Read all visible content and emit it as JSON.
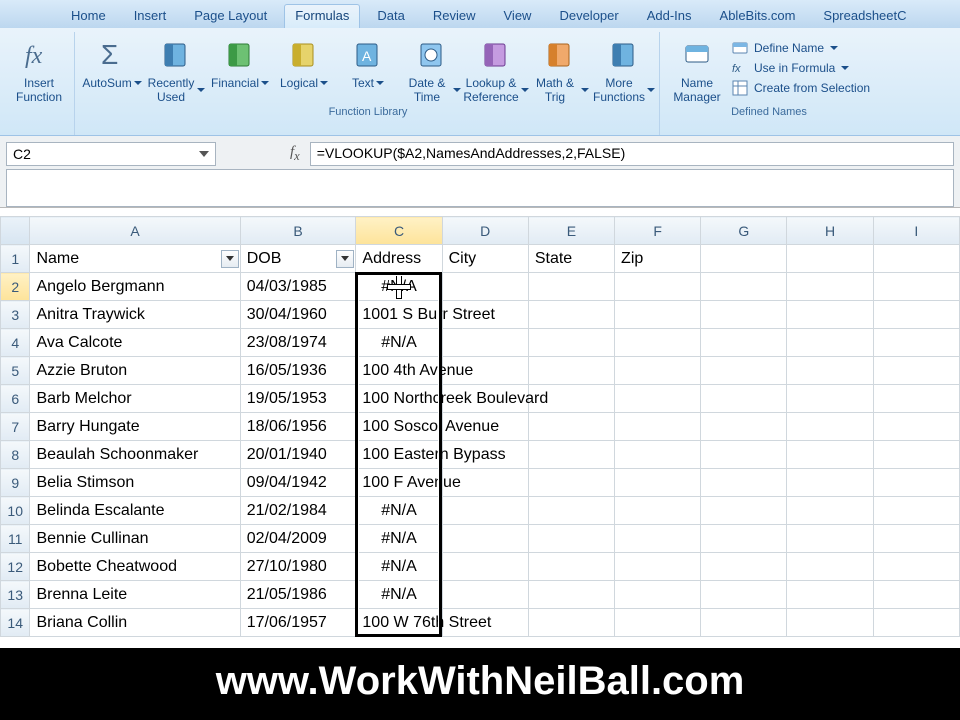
{
  "tabs": {
    "items": [
      "Home",
      "Insert",
      "Page Layout",
      "Formulas",
      "Data",
      "Review",
      "View",
      "Developer",
      "Add-Ins",
      "AbleBits.com",
      "SpreadsheetC"
    ],
    "activeIndex": 3
  },
  "ribbon": {
    "insertFunction": "Insert Function",
    "autosum": "AutoSum",
    "recent": "Recently Used",
    "financial": "Financial",
    "logical": "Logical",
    "text": "Text",
    "datetime": "Date & Time",
    "lookup": "Lookup & Reference",
    "math": "Math & Trig",
    "more": "More Functions",
    "nameMgr": "Name Manager",
    "defineName": "Define Name",
    "useInFormula": "Use in Formula",
    "createFromSel": "Create from Selection",
    "groupLibrary": "Function Library",
    "groupDefined": "Defined Names"
  },
  "formulaBar": {
    "nameBox": "C2",
    "formula": "=VLOOKUP($A2,NamesAndAddresses,2,FALSE)"
  },
  "columns": [
    "A",
    "B",
    "C",
    "D",
    "E",
    "F",
    "G",
    "H",
    "I"
  ],
  "headers": {
    "A": "Name",
    "B": "DOB",
    "C": "Address",
    "D": "City",
    "E": "State",
    "F": "Zip"
  },
  "rows": [
    {
      "n": "2",
      "name": "Angelo Bergmann",
      "dob": "04/03/1985",
      "addr": "#N/A"
    },
    {
      "n": "3",
      "name": "Anitra Traywick",
      "dob": "30/04/1960",
      "addr": "1001 S Burr Street"
    },
    {
      "n": "4",
      "name": "Ava Calcote",
      "dob": "23/08/1974",
      "addr": "#N/A"
    },
    {
      "n": "5",
      "name": "Azzie Bruton",
      "dob": "16/05/1936",
      "addr": "100 4th Avenue"
    },
    {
      "n": "6",
      "name": "Barb Melchor",
      "dob": "19/05/1953",
      "addr": "100 Northcreek Boulevard"
    },
    {
      "n": "7",
      "name": "Barry Hungate",
      "dob": "18/06/1956",
      "addr": "100 Soscol Avenue"
    },
    {
      "n": "8",
      "name": "Beaulah Schoonmaker",
      "dob": "20/01/1940",
      "addr": "100 Eastern Bypass"
    },
    {
      "n": "9",
      "name": "Belia Stimson",
      "dob": "09/04/1942",
      "addr": "100 F Avenue"
    },
    {
      "n": "10",
      "name": "Belinda Escalante",
      "dob": "21/02/1984",
      "addr": "#N/A"
    },
    {
      "n": "11",
      "name": "Bennie Cullinan",
      "dob": "02/04/2009",
      "addr": "#N/A"
    },
    {
      "n": "12",
      "name": "Bobette Cheatwood",
      "dob": "27/10/1980",
      "addr": "#N/A"
    },
    {
      "n": "13",
      "name": "Brenna Leite",
      "dob": "21/05/1986",
      "addr": "#N/A"
    },
    {
      "n": "14",
      "name": "Briana Collin",
      "dob": "17/06/1957",
      "addr": "100 W 76th Street"
    }
  ],
  "banner": "www.WorkWithNeilBall.com"
}
